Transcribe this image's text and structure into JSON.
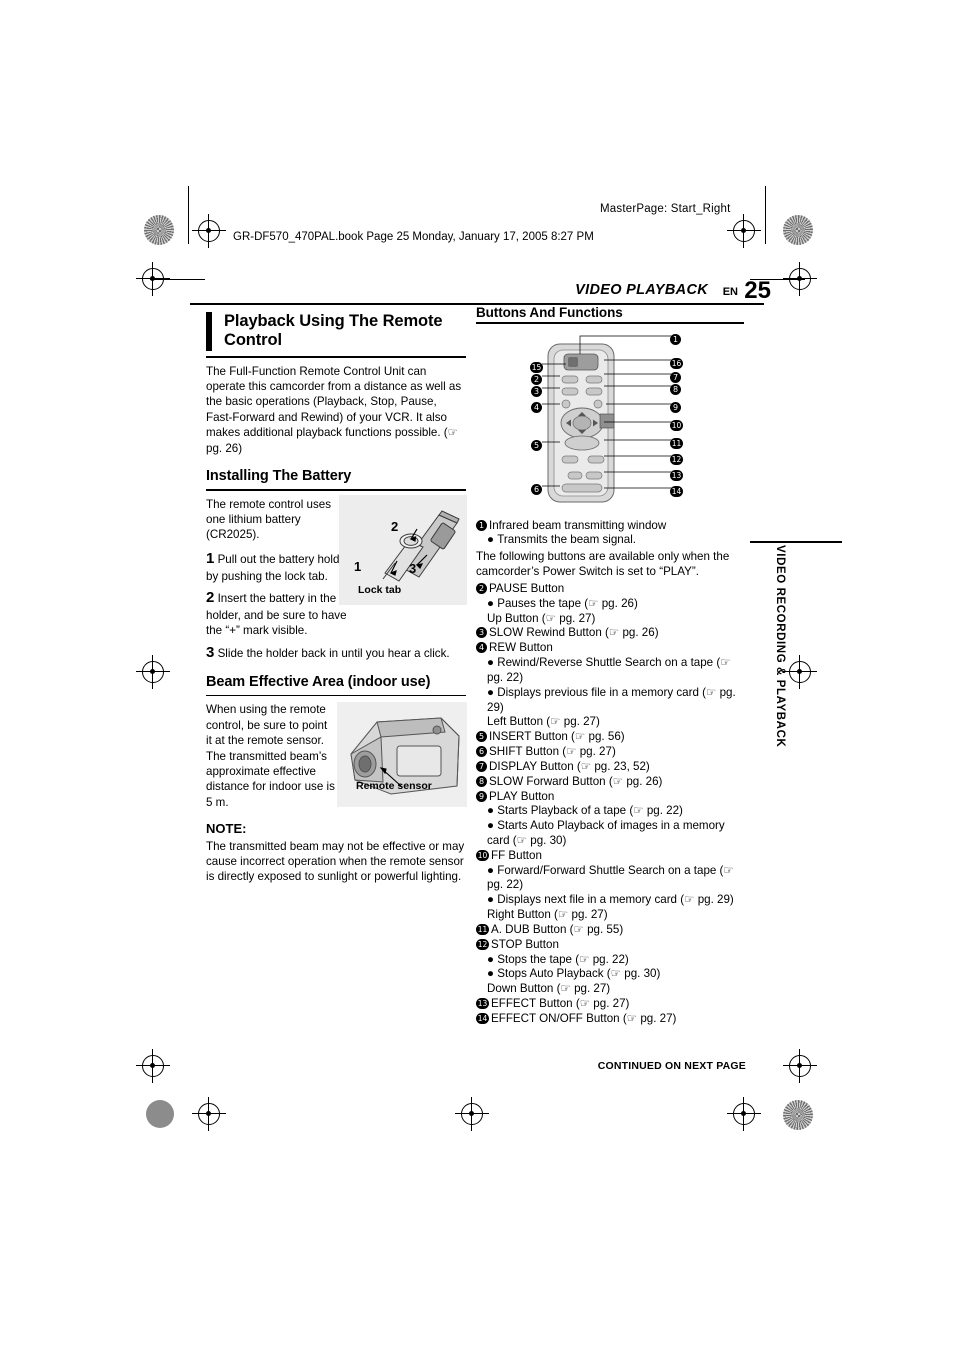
{
  "page": {
    "masterpage": "MasterPage: Start_Right",
    "bookline": "GR-DF570_470PAL.book  Page 25  Monday, January 17, 2005  8:27 PM",
    "header_title": "VIDEO PLAYBACK",
    "header_en": "EN",
    "page_number": "25",
    "side_tab": "VIDEO RECORDING & PLAYBACK",
    "continued": "CONTINUED ON NEXT PAGE"
  },
  "left": {
    "title": "Playback Using The Remote Control",
    "intro": "The Full-Function Remote Control Unit can operate this camcorder from a distance as well as the basic operations (Playback, Stop, Pause, Fast-Forward and Rewind) of your VCR. It also makes additional playback functions possible. (☞ pg. 26)",
    "section_battery": "Installing The Battery",
    "battery_intro": "The remote control uses one lithium battery (CR2025).",
    "step1_num": "1",
    "step1": "Pull out the battery holder by pushing the lock tab.",
    "step2_num": "2",
    "step2": "Insert the battery in the holder, and be sure to have the “+” mark visible.",
    "step3_num": "3",
    "step3": "Slide the holder back in until you hear a click.",
    "battery_labels": {
      "one": "1",
      "two": "2",
      "three": "3",
      "lock_tab": "Lock tab"
    },
    "section_beam": "Beam Effective Area (indoor use)",
    "beam_text": "When using the remote control, be sure to point it at the remote sensor. The transmitted beam’s approximate effective distance for indoor use is 5 m.",
    "remote_sensor_label": "Remote sensor",
    "note_label": "NOTE:",
    "note_text": "The transmitted beam may not be effective or may cause incorrect operation when the remote sensor is directly exposed to sunlight or powerful lighting."
  },
  "right": {
    "title": "Buttons And Functions",
    "callouts": [
      "1",
      "2",
      "3",
      "4",
      "5",
      "6",
      "7",
      "8",
      "9",
      "10",
      "11",
      "12",
      "13",
      "14",
      "15",
      "16"
    ],
    "items": [
      {
        "num": "1",
        "label": "Infrared beam transmitting window",
        "subs": [
          "Transmits the beam signal."
        ]
      },
      {
        "note": "The following buttons are available only when the camcorder’s Power Switch is set to “PLAY”."
      },
      {
        "num": "2",
        "label": "PAUSE Button",
        "subs": [
          "Pauses the tape (☞ pg. 26)"
        ],
        "extra": "Up Button (☞ pg. 27)"
      },
      {
        "num": "3",
        "label": "SLOW Rewind Button (☞ pg. 26)"
      },
      {
        "num": "4",
        "label": "REW Button",
        "subs": [
          "Rewind/Reverse Shuttle Search on a tape (☞ pg. 22)",
          "Displays previous file in a memory card (☞ pg. 29)"
        ],
        "extra": "Left Button (☞ pg. 27)"
      },
      {
        "num": "5",
        "label": "INSERT Button (☞ pg. 56)"
      },
      {
        "num": "6",
        "label": "SHIFT Button (☞ pg. 27)"
      },
      {
        "num": "7",
        "label": "DISPLAY Button (☞ pg. 23, 52)"
      },
      {
        "num": "8",
        "label": "SLOW Forward Button (☞ pg. 26)"
      },
      {
        "num": "9",
        "label": "PLAY Button",
        "subs": [
          "Starts Playback of a tape (☞ pg. 22)",
          "Starts Auto Playback of images in a memory card (☞ pg. 30)"
        ]
      },
      {
        "num": "10",
        "label": "FF Button",
        "subs": [
          "Forward/Forward Shuttle Search on a tape (☞ pg. 22)",
          "Displays next file in a memory card (☞ pg. 29)"
        ],
        "extra": "Right Button (☞ pg. 27)"
      },
      {
        "num": "11",
        "label": "A. DUB Button (☞ pg. 55)"
      },
      {
        "num": "12",
        "label": "STOP Button",
        "subs": [
          "Stops the tape (☞ pg. 22)",
          "Stops Auto Playback (☞ pg. 30)"
        ],
        "extra": "Down Button (☞ pg. 27)"
      },
      {
        "num": "13",
        "label": "EFFECT Button (☞ pg. 27)"
      },
      {
        "num": "14",
        "label": "EFFECT ON/OFF Button (☞ pg. 27)"
      }
    ]
  }
}
